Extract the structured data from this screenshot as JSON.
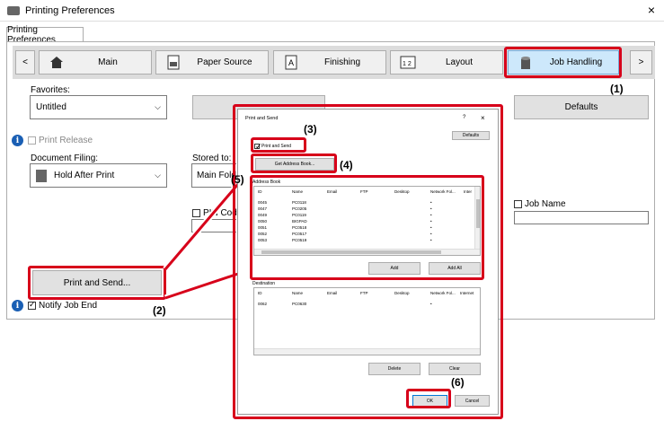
{
  "window": {
    "title": "Printing Preferences",
    "close": "×"
  },
  "tab_label": "Printing Preferences",
  "nav": {
    "prev": "<",
    "next": ">"
  },
  "tabs": [
    {
      "label": "Main",
      "icon": "home-icon"
    },
    {
      "label": "Paper Source",
      "icon": "paper-tray-icon"
    },
    {
      "label": "Finishing",
      "icon": "finishing-icon"
    },
    {
      "label": "Layout",
      "icon": "layout-icon"
    },
    {
      "label": "Job Handling",
      "icon": "job-handling-icon"
    }
  ],
  "favorites": {
    "label": "Favorites:",
    "value": "Untitled"
  },
  "defaults_label": "Defaults",
  "print_release": "Print Release",
  "document_filing": {
    "label": "Document Filing:",
    "value": "Hold After Print"
  },
  "stored_to": {
    "label": "Stored to:",
    "value": "Main Fold"
  },
  "pin_code": "PIN Cod",
  "job_name": "Job Name",
  "print_and_send_label": "Print and Send...",
  "notify_job_end": "Notify Job End",
  "callouts": {
    "c1": "(1)",
    "c2": "(2)",
    "c3": "(3)",
    "c4": "(4)",
    "c5": "(5)",
    "c6": "(6)"
  },
  "dialog": {
    "title": "Print and Send",
    "help": "?",
    "close": "×",
    "defaults": "Defaults",
    "print_and_send_check": "Print and Send",
    "get_address_book": "Get Address Book...",
    "address_book_label": "Address Book",
    "columns": [
      "ID",
      "Name",
      "Email",
      "FTP",
      "Desktop",
      "Network Fol...",
      "Inter"
    ],
    "rows": [
      {
        "id": "0045",
        "name": "PC0118",
        "mark": "•"
      },
      {
        "id": "0047",
        "name": "PC0205",
        "mark": "•"
      },
      {
        "id": "0049",
        "name": "PC0119",
        "mark": "•"
      },
      {
        "id": "0050",
        "name": "BIGPAD",
        "mark": "•"
      },
      {
        "id": "0051",
        "name": "PC0518",
        "mark": "•"
      },
      {
        "id": "0052",
        "name": "PC0517",
        "mark": "•"
      },
      {
        "id": "0053",
        "name": "PC0519",
        "mark": "•"
      }
    ],
    "add": "Add",
    "add_all": "Add All",
    "destination_label": "Destination",
    "dest_columns": [
      "ID",
      "Name",
      "Email",
      "FTP",
      "Desktop",
      "Network Fol...",
      "Internet"
    ],
    "dest_rows": [
      {
        "id": "0062",
        "name": "PC0630",
        "mark": "•"
      }
    ],
    "delete": "Delete",
    "clear": "Clear",
    "ok": "OK",
    "cancel": "Cancel"
  },
  "colors": {
    "accent_red": "#d7001a",
    "info_blue": "#1a5fb4"
  }
}
